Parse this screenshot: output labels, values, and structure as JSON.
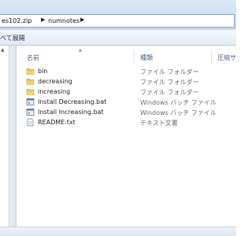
{
  "address": {
    "crumbs": [
      "es102.zip",
      "numnotes"
    ]
  },
  "toolbar": {
    "expand_all_label": "べて展開"
  },
  "columns": {
    "name": "名前",
    "type": "種類",
    "size": "圧縮サ"
  },
  "files": [
    {
      "name": "bin",
      "type": "ファイル フォルダー",
      "icon": "folder-icon"
    },
    {
      "name": "decreasing",
      "type": "ファイル フォルダー",
      "icon": "folder-icon"
    },
    {
      "name": "increasing",
      "type": "ファイル フォルダー",
      "icon": "folder-icon"
    },
    {
      "name": "Install Decreasing.bat",
      "type": "Windows バッチ ファイル",
      "icon": "batch-file-icon"
    },
    {
      "name": "Install Increasing.bat",
      "type": "Windows バッチ ファイル",
      "icon": "batch-file-icon"
    },
    {
      "name": "README.txt",
      "type": "テキスト文書",
      "icon": "text-file-icon"
    }
  ],
  "colors": {
    "column_header": "#4d6185",
    "folder": "#e7bb4d",
    "file_type_text": "#6d6d6d"
  }
}
